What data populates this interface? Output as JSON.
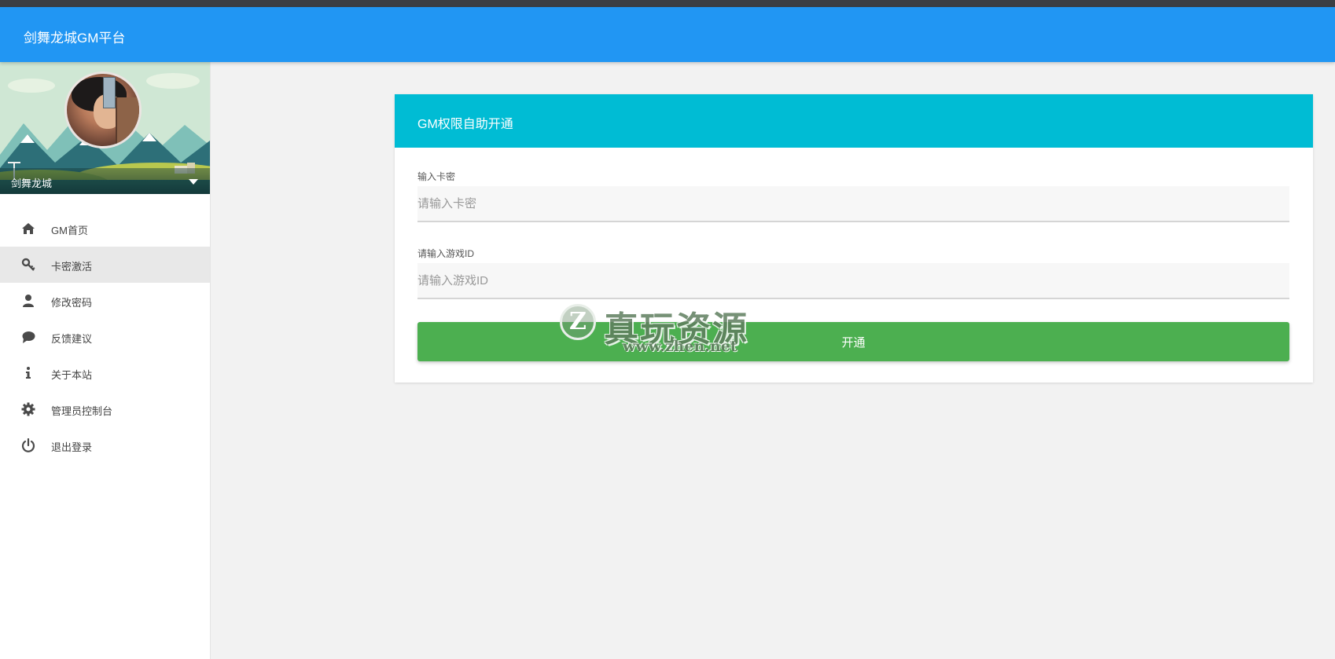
{
  "app": {
    "title": "剑舞龙城GM平台"
  },
  "profile": {
    "name": "剑舞龙城"
  },
  "menu": {
    "items": [
      {
        "label": "GM首页",
        "icon": "home-icon"
      },
      {
        "label": "卡密激活",
        "icon": "key-icon",
        "active": true
      },
      {
        "label": "修改密码",
        "icon": "user-icon"
      },
      {
        "label": "反馈建议",
        "icon": "chat-bubble-icon"
      },
      {
        "label": "关于本站",
        "icon": "info-icon"
      },
      {
        "label": "管理员控制台",
        "icon": "gear-icon"
      },
      {
        "label": "退出登录",
        "icon": "power-icon"
      }
    ]
  },
  "card": {
    "title": "GM权限自助开通",
    "card_field": {
      "label": "输入卡密",
      "placeholder": "请输入卡密",
      "value": ""
    },
    "game_id_field": {
      "label": "请输入游戏ID",
      "placeholder": "请输入游戏ID",
      "value": ""
    },
    "submit_label": "开通"
  },
  "watermark": {
    "title": "真玩资源",
    "url": "www.zhen.net",
    "logo_letter": "Z"
  },
  "colors": {
    "header": "#2196f3",
    "card_header": "#00bcd4",
    "submit": "#4caf50",
    "active_menu": "#e8e8e8",
    "background": "#f2f2f2"
  }
}
